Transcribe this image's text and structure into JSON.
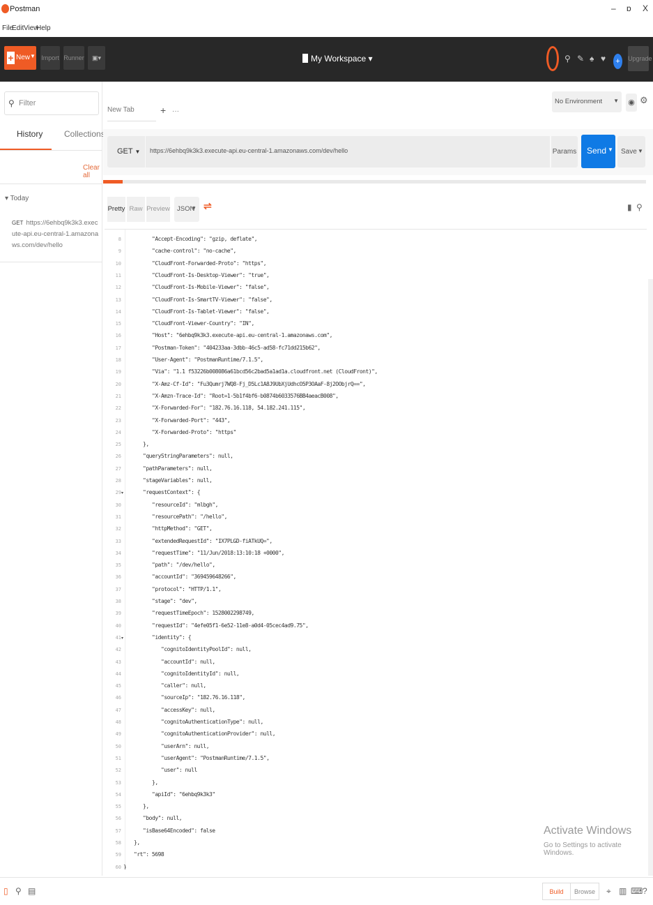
{
  "titlebar": {
    "app_name": "Postman",
    "minimize": "–",
    "maximize": "ɒ",
    "close": "X"
  },
  "menubar": [
    "File",
    "Edit",
    "View",
    "Help"
  ],
  "header": {
    "new_label": "New",
    "import_label": "Import",
    "runner_label": "Runner",
    "workspace": "My Workspace",
    "upgrade_label": "Upgrade"
  },
  "sidebar": {
    "filter_placeholder": "Filter",
    "tabs": [
      "History",
      "Collections"
    ],
    "clear_all": "Clear all",
    "group": "Today",
    "history_items": [
      {
        "method": "GET",
        "url": "https://6ehbq9k3k3.execute-api.eu-central-1.amazonaws.com/dev/hello"
      }
    ]
  },
  "request": {
    "tab_label": "New Tab",
    "environment": "No Environment",
    "method": "GET",
    "url": "https://6ehbq9k3k3.execute-api.eu-central-1.amazonaws.com/dev/hello",
    "params_label": "Params",
    "send_label": "Send",
    "save_label": "Save"
  },
  "response": {
    "view_tabs": [
      "Pretty",
      "Raw",
      "Preview"
    ],
    "format": "JSON",
    "lines": [
      {
        "n": "8",
        "indent": 2,
        "text": "\"Accept-Encoding\": \"gzip, deflate\","
      },
      {
        "n": "9",
        "indent": 2,
        "text": "\"cache-control\": \"no-cache\","
      },
      {
        "n": "10",
        "indent": 2,
        "text": "\"CloudFront-Forwarded-Proto\": \"https\","
      },
      {
        "n": "11",
        "indent": 2,
        "text": "\"CloudFront-Is-Desktop-Viewer\": \"true\","
      },
      {
        "n": "12",
        "indent": 2,
        "text": "\"CloudFront-Is-Mobile-Viewer\": \"false\","
      },
      {
        "n": "13",
        "indent": 2,
        "text": "\"CloudFront-Is-SmartTV-Viewer\": \"false\","
      },
      {
        "n": "14",
        "indent": 2,
        "text": "\"CloudFront-Is-Tablet-Viewer\": \"false\","
      },
      {
        "n": "15",
        "indent": 2,
        "text": "\"CloudFront-Viewer-Country\": \"IN\","
      },
      {
        "n": "16",
        "indent": 2,
        "text": "\"Host\": \"6ehbq9k3k3.execute-api.eu-central-1.amazonaws.com\","
      },
      {
        "n": "17",
        "indent": 2,
        "text": "\"Postman-Token\": \"404233aa-3dbb-46c5-ad58-fc71dd215b62\","
      },
      {
        "n": "18",
        "indent": 2,
        "text": "\"User-Agent\": \"PostmanRuntime/7.1.5\","
      },
      {
        "n": "19",
        "indent": 2,
        "text": "\"Via\": \"1.1 f53226b008086a61bcd56c2bad5a1ad1a.cloudfront.net (CloudFront)\","
      },
      {
        "n": "20",
        "indent": 2,
        "text": "\"X-Amz-Cf-Id\": \"Fu3Qumrj7WQ8-Fj_D5Lc1A8J9UbXjUdhcO5P3OAaF-8j2OObjrQ==\","
      },
      {
        "n": "21",
        "indent": 2,
        "text": "\"X-Amzn-Trace-Id\": \"Root=1-5b1f4bf6-b0874b6033576BB4aeacB008\","
      },
      {
        "n": "22",
        "indent": 2,
        "text": "\"X-Forwarded-For\": \"182.76.16.118, 54.182.241.115\","
      },
      {
        "n": "23",
        "indent": 2,
        "text": "\"X-Forwarded-Port\": \"443\","
      },
      {
        "n": "24",
        "indent": 2,
        "text": "\"X-Forwarded-Proto\": \"https\""
      },
      {
        "n": "25",
        "indent": 1,
        "text": "},"
      },
      {
        "n": "26",
        "indent": 1,
        "text": "\"queryStringParameters\": null,"
      },
      {
        "n": "27",
        "indent": 1,
        "text": "\"pathParameters\": null,"
      },
      {
        "n": "28",
        "indent": 1,
        "text": "\"stageVariables\": null,"
      },
      {
        "n": "29",
        "indent": 1,
        "text": "\"requestContext\": {",
        "fold": true
      },
      {
        "n": "30",
        "indent": 2,
        "text": "\"resourceId\": \"mlbgh\","
      },
      {
        "n": "31",
        "indent": 2,
        "text": "\"resourcePath\": \"/hello\","
      },
      {
        "n": "32",
        "indent": 2,
        "text": "\"httpMethod\": \"GET\","
      },
      {
        "n": "33",
        "indent": 2,
        "text": "\"extendedRequestId\": \"IX7PLGD-fiATkUQ=\","
      },
      {
        "n": "34",
        "indent": 2,
        "text": "\"requestTime\": \"11/Jun/2018:13:10:18 +0000\","
      },
      {
        "n": "35",
        "indent": 2,
        "text": "\"path\": \"/dev/hello\","
      },
      {
        "n": "36",
        "indent": 2,
        "text": "\"accountId\": \"369459648266\","
      },
      {
        "n": "37",
        "indent": 2,
        "text": "\"protocol\": \"HTTP/1.1\","
      },
      {
        "n": "38",
        "indent": 2,
        "text": "\"stage\": \"dev\","
      },
      {
        "n": "39",
        "indent": 2,
        "text": "\"requestTimeEpoch\": 1528002298749,"
      },
      {
        "n": "40",
        "indent": 2,
        "text": "\"requestId\": \"4efe05f1-6e52-11e8-a0d4-05cec4ad9.75\","
      },
      {
        "n": "41",
        "indent": 2,
        "text": "\"identity\": {",
        "fold": true
      },
      {
        "n": "42",
        "indent": 3,
        "text": "\"cognitoIdentityPoolId\": null,"
      },
      {
        "n": "43",
        "indent": 3,
        "text": "\"accountId\": null,"
      },
      {
        "n": "44",
        "indent": 3,
        "text": "\"cognitoIdentityId\": null,"
      },
      {
        "n": "45",
        "indent": 3,
        "text": "\"caller\": null,"
      },
      {
        "n": "46",
        "indent": 3,
        "text": "\"sourceIp\": \"182.76.16.118\","
      },
      {
        "n": "47",
        "indent": 3,
        "text": "\"accessKey\": null,"
      },
      {
        "n": "48",
        "indent": 3,
        "text": "\"cognitoAuthenticationType\": null,"
      },
      {
        "n": "49",
        "indent": 3,
        "text": "\"cognitoAuthenticationProvider\": null,"
      },
      {
        "n": "50",
        "indent": 3,
        "text": "\"userArn\": null,"
      },
      {
        "n": "51",
        "indent": 3,
        "text": "\"userAgent\": \"PostmanRuntime/7.1.5\","
      },
      {
        "n": "52",
        "indent": 3,
        "text": "\"user\": null"
      },
      {
        "n": "53",
        "indent": 2,
        "text": "},"
      },
      {
        "n": "54",
        "indent": 2,
        "text": "\"apiId\": \"6ehbq9k3k3\""
      },
      {
        "n": "55",
        "indent": 1,
        "text": "},"
      },
      {
        "n": "56",
        "indent": 1,
        "text": "\"body\": null,"
      },
      {
        "n": "57",
        "indent": 1,
        "text": "\"isBase64Encoded\": false"
      },
      {
        "n": "58",
        "indent": 0,
        "text": "},"
      },
      {
        "n": "59",
        "indent": 0,
        "text": "\"rt\": 5698"
      },
      {
        "n": "60",
        "indent": -1,
        "text": "}"
      }
    ]
  },
  "watermark": {
    "title": "Activate Windows",
    "subtitle": "Go to Settings to activate Windows."
  },
  "statusbar": {
    "build_label": "Build",
    "browse_label": "Browse"
  },
  "colors": {
    "accent": "#ef5b25",
    "send": "#0f7ae5",
    "header_bg": "#282828"
  }
}
